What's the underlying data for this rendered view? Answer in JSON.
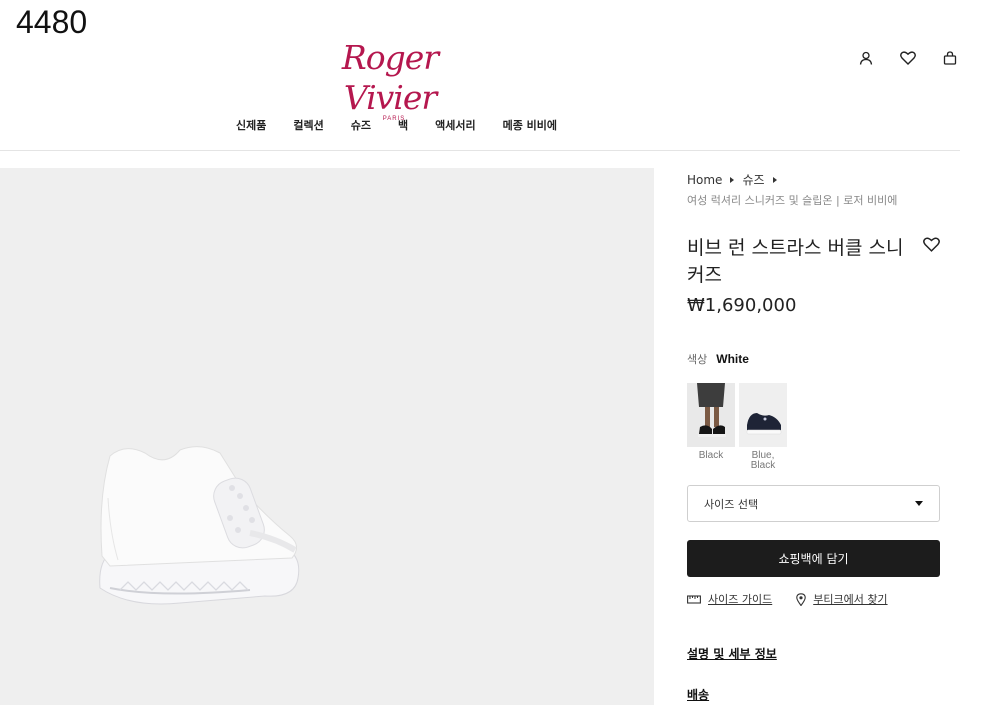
{
  "overlay": {
    "corner_number": "4480"
  },
  "brand": {
    "script": "Roger Vivier",
    "city": "PARIS"
  },
  "header_icons": [
    "user-icon",
    "heart-icon",
    "shopping-bag-icon"
  ],
  "nav": [
    "신제품",
    "컬렉션",
    "슈즈",
    "백",
    "액세서리",
    "메종 비비에"
  ],
  "breadcrumb": {
    "home": "Home",
    "category": "슈즈",
    "sub": "여성 럭셔리 스니커즈 및 슬립온 | 로저 비비에"
  },
  "product": {
    "title": "비브 런 스트라스 버클 스니커즈",
    "price": "₩1,690,000",
    "color_label": "색상",
    "color_value": "White",
    "swatches": [
      {
        "label": "Black"
      },
      {
        "label": "Blue, Black"
      }
    ],
    "size_placeholder": "사이즈 선택",
    "add_to_bag": "쇼핑백에 담기",
    "size_guide": "사이즈 가이드",
    "find_boutique": "부티크에서 찾기",
    "details_link": "설명 및 세부 정보",
    "shipping_link": "배송"
  },
  "colors": {
    "brand": "#b5174e",
    "button": "#1c1c1c",
    "image_bg": "#efefef"
  }
}
